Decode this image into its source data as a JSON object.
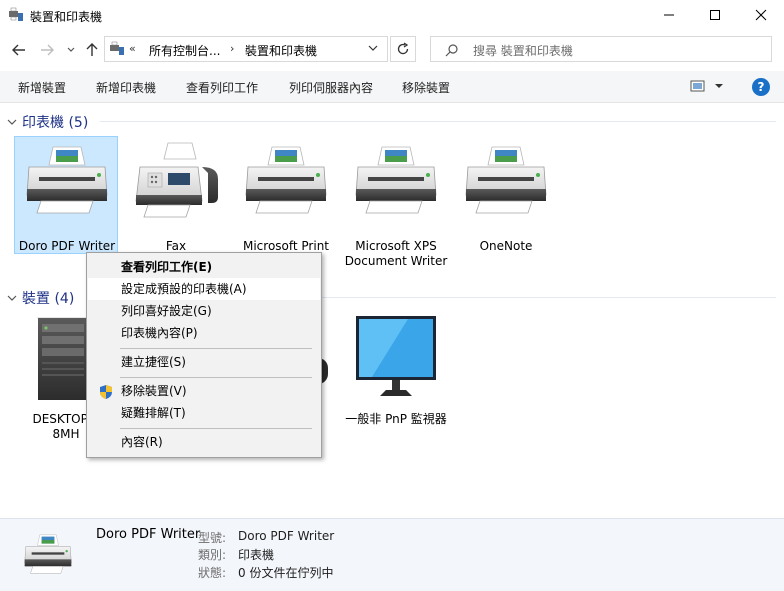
{
  "window": {
    "title": "裝置和印表機",
    "controls": {
      "minimize": "minimize-icon",
      "maximize": "maximize-icon",
      "close": "close-icon"
    }
  },
  "address": {
    "overflow": "«",
    "crumbs": [
      "所有控制台...",
      "裝置和印表機"
    ],
    "separator": "›",
    "search_placeholder": "搜尋 裝置和印表機"
  },
  "toolbar": {
    "commands": [
      "新增裝置",
      "新增印表機",
      "查看列印工作",
      "列印伺服器內容",
      "移除裝置"
    ],
    "help_label": "?"
  },
  "groups": {
    "printers": {
      "label": "印表機 (5)",
      "items": [
        {
          "name": "Doro PDF Writer",
          "icon": "printer-icon",
          "selected": true
        },
        {
          "name": "Fax",
          "icon": "fax-icon"
        },
        {
          "name": "Microsoft Print",
          "icon": "printer-icon"
        },
        {
          "name": "Microsoft XPS Document Writer",
          "icon": "printer-icon"
        },
        {
          "name": "OneNote",
          "icon": "printer-icon"
        }
      ]
    },
    "devices": {
      "label": "裝置 (4)",
      "items": [
        {
          "name": "DESKTOP-S\n8MH",
          "icon": "computer-tower-icon"
        },
        {
          "name": "一般非 PnP 監視器",
          "icon": "monitor-icon"
        }
      ]
    }
  },
  "context_menu": {
    "items": [
      {
        "label": "查看列印工作(E)",
        "bold": true
      },
      {
        "label": "設定成預設的印表機(A)",
        "hover": true
      },
      {
        "label": "列印喜好設定(G)"
      },
      {
        "label": "印表機內容(P)"
      },
      {
        "label": "建立捷徑(S)"
      },
      {
        "label": "移除裝置(V)",
        "icon": "shield-icon"
      },
      {
        "label": "疑難排解(T)"
      },
      {
        "label": "內容(R)"
      }
    ]
  },
  "details": {
    "name": "Doro PDF Writer",
    "fields": [
      {
        "key": "型號:",
        "value": "Doro PDF Writer"
      },
      {
        "key": "類別:",
        "value": "印表機"
      },
      {
        "key": "狀態:",
        "value": "0 份文件在佇列中"
      }
    ]
  },
  "colors": {
    "accent": "#1a6fc7",
    "selection": "#cce8ff",
    "group_header": "#1e3287"
  }
}
